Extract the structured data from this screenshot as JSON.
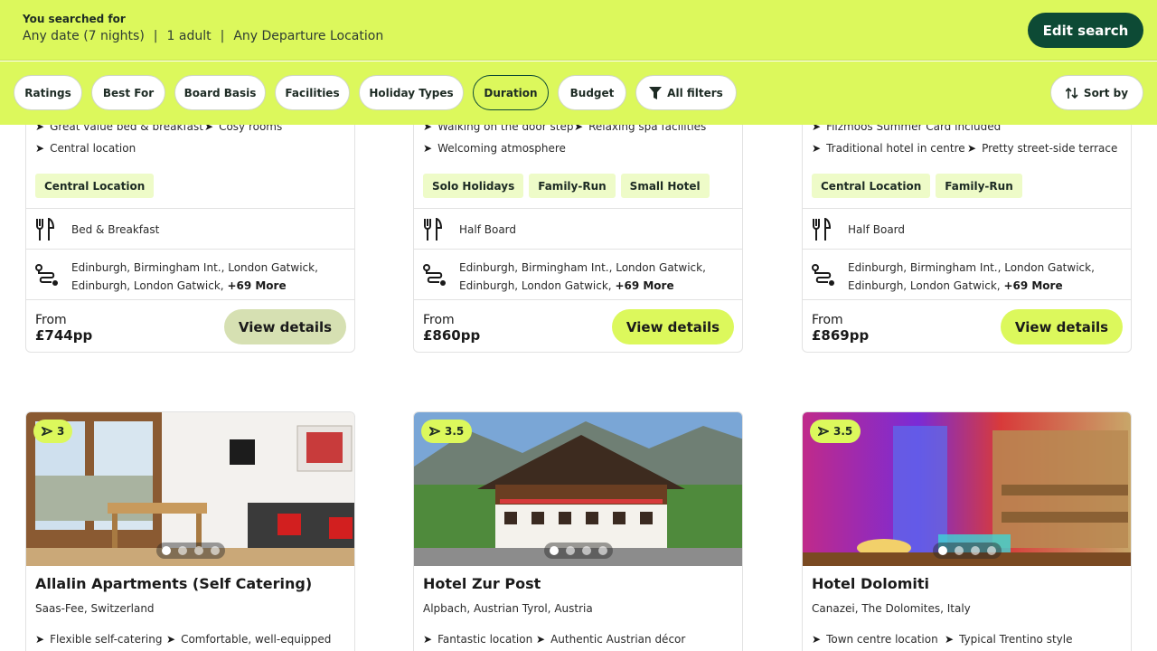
{
  "search": {
    "label": "You searched for",
    "date": "Any date (7 nights)",
    "guests": "1 adult",
    "departure": "Any Departure Location",
    "separator": "|",
    "edit_label": "Edit search"
  },
  "filters": {
    "items": [
      "Ratings",
      "Best For",
      "Board Basis",
      "Facilities",
      "Holiday Types",
      "Duration",
      "Budget"
    ],
    "active": "Duration",
    "all_filters": "All filters",
    "sort": "Sort by"
  },
  "top_cards": [
    {
      "features_row1": [
        "Great value bed & breakfast",
        "Cosy rooms"
      ],
      "features_row2": [
        "Central location"
      ],
      "tags": [
        "Central Location"
      ],
      "board": "Bed & Breakfast",
      "airports_line1": "Edinburgh, Birmingham Int., London Gatwick,",
      "airports_line2": "Edinburgh, London Gatwick,",
      "more": "+69 More",
      "from": "From",
      "price": "£744pp",
      "cta": "View details"
    },
    {
      "features_row1": [
        "Walking on the door step",
        "Relaxing spa facilities"
      ],
      "features_row2": [
        "Welcoming atmosphere"
      ],
      "tags": [
        "Solo Holidays",
        "Family-Run",
        "Small Hotel"
      ],
      "board": "Half Board",
      "airports_line1": "Edinburgh, Birmingham Int., London Gatwick,",
      "airports_line2": "Edinburgh, London Gatwick,",
      "more": "+69 More",
      "from": "From",
      "price": "£860pp",
      "cta": "View details"
    },
    {
      "features_row1": [
        "Filzmoos Summer Card included"
      ],
      "features_row2": [
        "Traditional hotel in centre",
        "Pretty street-side terrace"
      ],
      "tags": [
        "Central Location",
        "Family-Run"
      ],
      "board": "Half Board",
      "airports_line1": "Edinburgh, Birmingham Int., London Gatwick,",
      "airports_line2": "Edinburgh, London Gatwick,",
      "more": "+69 More",
      "from": "From",
      "price": "£869pp",
      "cta": "View details"
    }
  ],
  "bottom_cards": [
    {
      "rating": "3",
      "name": "Allalin Apartments (Self Catering)",
      "location": "Saas-Fee, Switzerland",
      "features": [
        "Flexible self-catering",
        "Comfortable, well-equipped"
      ]
    },
    {
      "rating": "3.5",
      "name": "Hotel Zur Post",
      "location": "Alpbach, Austrian Tyrol, Austria",
      "features": [
        "Fantastic location",
        "Authentic Austrian décor"
      ]
    },
    {
      "rating": "3.5",
      "name": "Hotel Dolomiti",
      "location": "Canazei, The Dolomites, Italy",
      "features": [
        "Town centre location",
        "Typical Trentino style"
      ]
    }
  ],
  "icons": {
    "feature": "arrow-icon",
    "board": "cutlery-icon",
    "airports": "route-icon",
    "rating": "rating-arrow-icon",
    "filter": "funnel-icon",
    "sort": "sort-icon"
  },
  "colors": {
    "brand_lime": "#dcf85c",
    "brand_green": "#0d4a35",
    "tag_bg": "#eefbc8"
  }
}
